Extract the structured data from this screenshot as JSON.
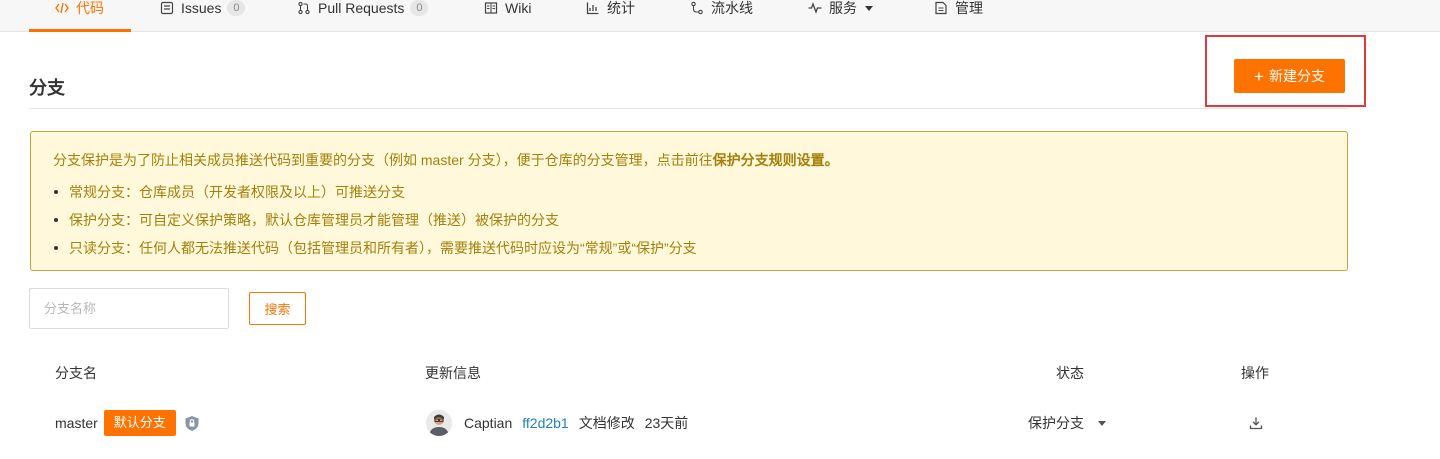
{
  "tabs": [
    {
      "label": "代码",
      "icon": "code-icon",
      "active": true
    },
    {
      "label": "Issues",
      "icon": "issues-icon",
      "count": "0"
    },
    {
      "label": "Pull Requests",
      "icon": "pull-request-icon",
      "count": "0"
    },
    {
      "label": "Wiki",
      "icon": "wiki-icon"
    },
    {
      "label": "统计",
      "icon": "stats-icon"
    },
    {
      "label": "流水线",
      "icon": "pipeline-icon"
    },
    {
      "label": "服务",
      "icon": "service-icon",
      "dropdown": true
    },
    {
      "label": "管理",
      "icon": "manage-icon"
    }
  ],
  "heading": "分支",
  "new_branch_label": "新建分支",
  "notice": {
    "intro": "分支保护是为了防止相关成员推送代码到重要的分支（例如 master 分支），便于仓库的分支管理，点击前往",
    "intro_link": "保护分支规则设置。",
    "items": [
      "常规分支：仓库成员（开发者权限及以上）可推送分支",
      "保护分支：可自定义保护策略，默认仓库管理员才能管理（推送）被保护的分支",
      "只读分支：任何人都无法推送代码（包括管理员和所有者），需要推送代码时应设为“常规”或“保护”分支"
    ]
  },
  "search": {
    "placeholder": "分支名称",
    "button": "搜索"
  },
  "table": {
    "headers": {
      "name": "分支名",
      "update": "更新信息",
      "status": "状态",
      "actions": "操作"
    },
    "rows": [
      {
        "name": "master",
        "default_badge": "默认分支",
        "author": "Captian",
        "commit": "ff2d2b1",
        "message": "文档修改",
        "time": "23天前",
        "status": "保护分支"
      }
    ]
  },
  "colors": {
    "accent": "#fe7300",
    "highlight_border": "#e0393e",
    "notice_bg": "#fff8db",
    "notice_text": "#a4800b",
    "link": "#1e7fc4"
  }
}
